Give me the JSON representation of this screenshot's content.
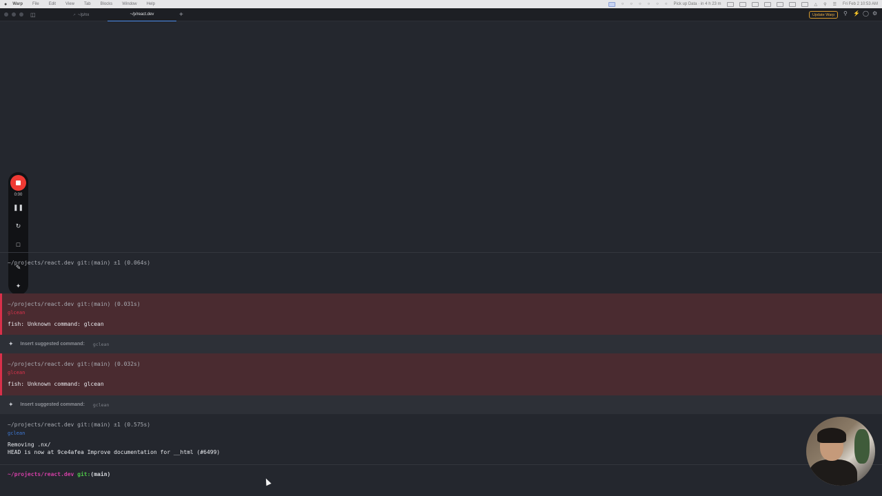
{
  "menubar": {
    "app": "Warp",
    "items": [
      "File",
      "Edit",
      "View",
      "Tab",
      "Blocks",
      "Window",
      "Help"
    ],
    "status_text": "Pick up Data · in 4 h 23 m",
    "clock": "Fri Feb 2  10:53 AM"
  },
  "tabs": [
    {
      "label": "~/p/nx",
      "active": false
    },
    {
      "label": "~/p/react.dev",
      "active": true
    }
  ],
  "update_button": "Update Warp",
  "recorder": {
    "time": "0:00"
  },
  "blocks": {
    "b1": {
      "header": "~/projects/react.dev git:(main) ±1 (0.064s)"
    },
    "b2": {
      "header": "~/projects/react.dev git:(main) (0.031s)",
      "command": "glcean",
      "output": "fish: Unknown command: glcean"
    },
    "s1": {
      "label": "Insert suggested command:",
      "command": "gclean"
    },
    "b3": {
      "header": "~/projects/react.dev git:(main) (0.032s)",
      "command": "glcean",
      "output": "fish: Unknown command: glcean"
    },
    "s2": {
      "label": "Insert suggested command:",
      "command": "gclean"
    },
    "b4": {
      "header": "~/projects/react.dev git:(main) ±1 (0.575s)",
      "command": "gclean",
      "output1": "Removing .nx/",
      "output2": "HEAD is now at 9ce4afea Improve documentation for __html (#6499)"
    }
  },
  "prompt": {
    "path": "~/projects/react.dev",
    "git": "git:",
    "branch": "(main)"
  },
  "colors": {
    "error_bg": "#4a2b30",
    "error_bar": "#d9304a",
    "accent": "#4d8ff0",
    "update": "#e5a942"
  }
}
